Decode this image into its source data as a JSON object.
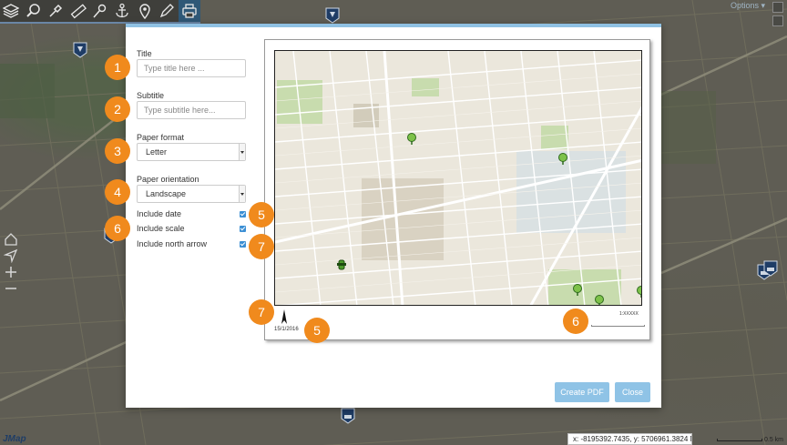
{
  "toolbar": {
    "items": [
      {
        "name": "layers-icon"
      },
      {
        "name": "search-icon"
      },
      {
        "name": "tools-icon"
      },
      {
        "name": "measure-ruler-icon"
      },
      {
        "name": "pushpin-icon"
      },
      {
        "name": "anchor-icon"
      },
      {
        "name": "map-marker-icon"
      },
      {
        "name": "pencil-ruler-icon"
      },
      {
        "name": "print-icon",
        "active": true
      }
    ]
  },
  "top_right": {
    "options_label": "Options ▾"
  },
  "print_dialog": {
    "title_field": {
      "label": "Title",
      "placeholder": "Type title here ..."
    },
    "subtitle_field": {
      "label": "Subtitle",
      "placeholder": "Type subtitle here..."
    },
    "paper_format": {
      "label": "Paper format",
      "value": "Letter"
    },
    "paper_orientation": {
      "label": "Paper orientation",
      "value": "Landscape"
    },
    "include_date": {
      "label": "Include date",
      "checked": true
    },
    "include_scale": {
      "label": "Include scale",
      "checked": true
    },
    "include_north_arrow": {
      "label": "Include north arrow",
      "checked": true
    },
    "preview": {
      "date": "15/1/2016",
      "scale_text": "1:XXXXX"
    },
    "buttons": {
      "create_pdf": "Create PDF",
      "close": "Close"
    }
  },
  "callouts": [
    "1",
    "2",
    "3",
    "4",
    "5",
    "6",
    "7",
    "7",
    "5",
    "6"
  ],
  "status_bar": {
    "coordinates": "x: -8195392.7435, y: 5706961.3824 Meters",
    "scale_label": "0.5 km",
    "logo": "JMap"
  },
  "colors": {
    "accent": "#8fc3e6",
    "badge": "#f08a1d",
    "checkbox": "#3c8fd4",
    "toolbar_active": "#2f5877"
  }
}
